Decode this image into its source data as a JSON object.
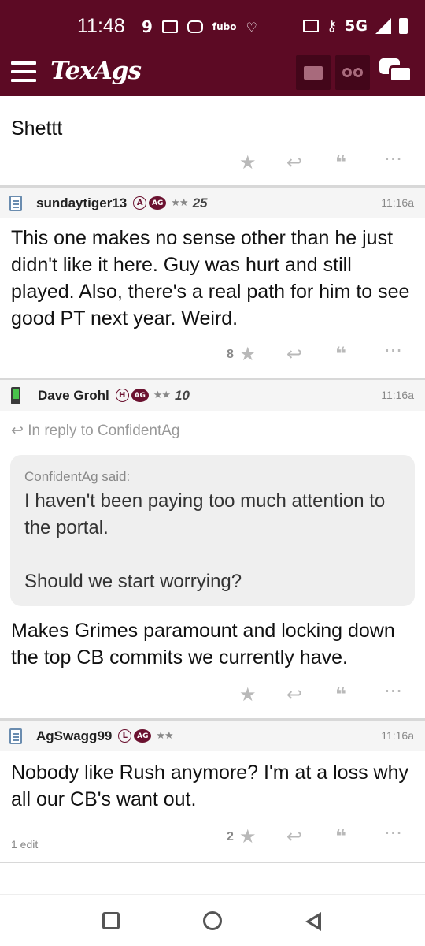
{
  "status_bar": {
    "time": "11:48",
    "left_icons": [
      "9",
      "mail-icon",
      "instagram-icon",
      "fubo-icon",
      "iheart-icon"
    ],
    "fubo_label": "fubo",
    "network": "5G",
    "right_icons": [
      "nfc-icon",
      "key-icon",
      "signal-icon",
      "battery-icon"
    ]
  },
  "app_bar": {
    "logo": "TexAgs",
    "colors": {
      "brand": "#5c0a24",
      "button_bg": "#43061a"
    }
  },
  "posts": [
    {
      "username": "",
      "time": "",
      "body": "Shettt",
      "like_count": "",
      "partial": true
    },
    {
      "username": "sundaytiger13",
      "badge": "A",
      "ag_badge": "AG",
      "stars": "★★",
      "years": "25",
      "time": "11:16a",
      "body": "This one makes no sense other than he just didn't like it here. Guy was hurt and still played. Also, there's a real path for him to see good PT next year. Weird.",
      "like_count": "8"
    },
    {
      "username": "Dave Grohl",
      "badge": "H",
      "ag_badge": "AG",
      "stars": "★★",
      "years": "10",
      "time": "11:16a",
      "reply_to": "In reply to ConfidentAg",
      "quote_author": "ConfidentAg said:",
      "quote_line1": "I haven't been paying too much attention to the portal.",
      "quote_line2": "Should we start worrying?",
      "body": "Makes Grimes paramount and locking down the top CB commits we currently have.",
      "like_count": ""
    },
    {
      "username": "AgSwagg99",
      "badge": "L",
      "ag_badge": "AG",
      "stars": "★★",
      "time": "11:16a",
      "body": "Nobody like Rush anymore? I'm at a loss why all our CB's want out.",
      "like_count": "2",
      "edit_note": "1 edit"
    }
  ],
  "action_icons": [
    "star-icon",
    "reply-icon",
    "quote-icon",
    "more-icon"
  ],
  "nav_bar": [
    "recent-apps-button",
    "home-button",
    "back-button"
  ]
}
